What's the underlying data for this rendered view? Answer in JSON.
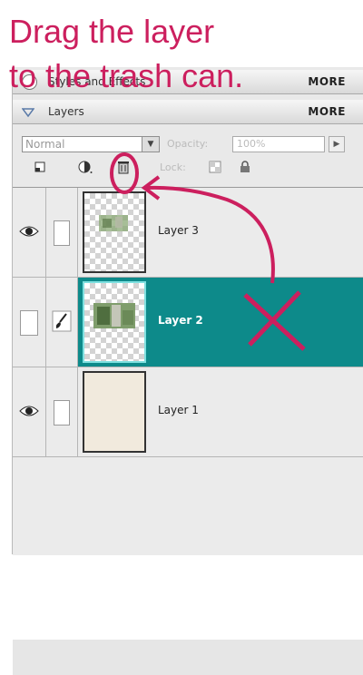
{
  "annotation": {
    "line1": "Drag the layer",
    "line2": "to the trash can.",
    "color": "#cc1f5e"
  },
  "styles_panel": {
    "label": "Styles and Effects",
    "more": "MORE"
  },
  "layers_panel": {
    "title": "Layers",
    "more": "MORE",
    "blend_mode": "Normal",
    "opacity_label": "Opacity:",
    "opacity_value": "100%",
    "lock_label": "Lock:",
    "icons": [
      "new-layer-icon",
      "adjustment-layer-icon",
      "trash-can-icon",
      "lock-transparency-icon",
      "lock-all-icon"
    ]
  },
  "layers": [
    {
      "name": "Layer 3",
      "visible": true,
      "selected": false
    },
    {
      "name": "Layer 2",
      "visible": false,
      "selected": true
    },
    {
      "name": "Layer 1",
      "visible": true,
      "selected": false
    }
  ],
  "colors": {
    "selection": "#0d8a8a",
    "annotation": "#cc1f5e"
  }
}
